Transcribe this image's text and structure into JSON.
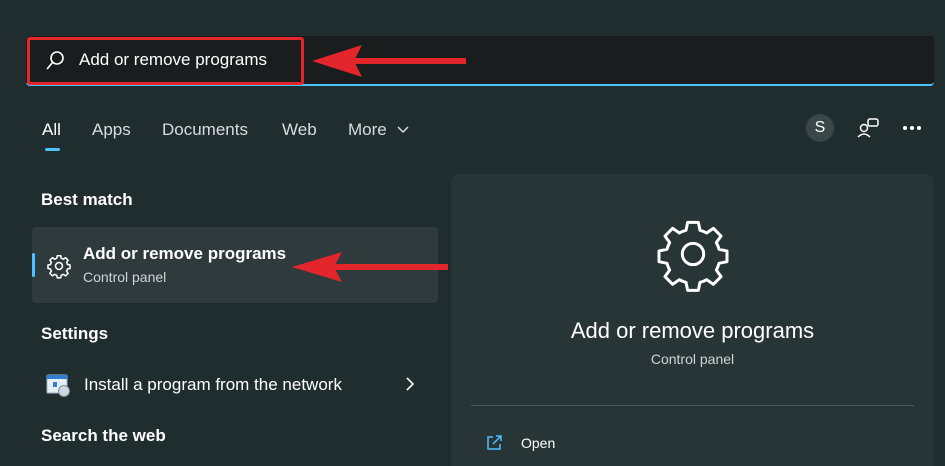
{
  "search": {
    "query": "Add or remove programs"
  },
  "tabs": [
    {
      "label": "All",
      "active": true
    },
    {
      "label": "Apps"
    },
    {
      "label": "Documents"
    },
    {
      "label": "Web"
    },
    {
      "label": "More"
    }
  ],
  "header": {
    "avatar_initial": "S"
  },
  "sections": {
    "best_match": "Best match",
    "settings": "Settings",
    "search_web": "Search the web"
  },
  "best_match": {
    "title": "Add or remove programs",
    "subtitle": "Control panel",
    "icon": "gear-icon"
  },
  "settings_items": [
    {
      "label": "Install a program from the network",
      "icon": "network-install-icon"
    }
  ],
  "preview": {
    "title": "Add or remove programs",
    "subtitle": "Control panel",
    "icon": "gear-icon",
    "actions": [
      {
        "label": "Open",
        "icon": "open-external-icon"
      }
    ]
  },
  "colors": {
    "background": "#1f2d2e",
    "accent": "#4cc2ff",
    "annotation_red": "#e3262b"
  }
}
